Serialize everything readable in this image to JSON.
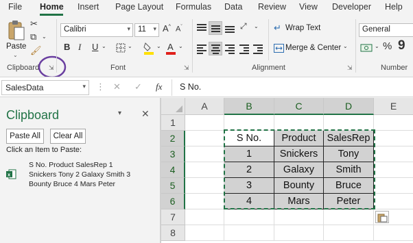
{
  "tabs": [
    "File",
    "Home",
    "Insert",
    "Page Layout",
    "Formulas",
    "Data",
    "Review",
    "View",
    "Developer",
    "Help"
  ],
  "active_tab": "Home",
  "accent_color": "#217346",
  "clipboard_group": {
    "paste_label": "Paste",
    "group_label": "Clipboard"
  },
  "font_group": {
    "font_name": "Calibri",
    "font_size": "11",
    "bold": "B",
    "italic": "I",
    "underline": "U",
    "group_label": "Font"
  },
  "alignment_group": {
    "wrap_text": "Wrap Text",
    "merge_center": "Merge & Center",
    "group_label": "Alignment"
  },
  "number_group": {
    "format": "General",
    "percent": "%",
    "comma": "9",
    "group_label": "Number"
  },
  "formula_bar": {
    "name_box": "SalesData",
    "fx": "fx",
    "content": "S No."
  },
  "clipboard_pane": {
    "title": "Clipboard",
    "paste_all": "Paste All",
    "clear_all": "Clear All",
    "instruction": "Click an Item to Paste:",
    "item_lines": [
      "S No. Product SalesRep 1",
      "Snickers Tony 2 Galaxy Smith 3",
      "Bounty Bruce 4 Mars Peter"
    ]
  },
  "sheet": {
    "columns": [
      "A",
      "B",
      "C",
      "D",
      "E"
    ],
    "rows": [
      "1",
      "2",
      "3",
      "4",
      "5",
      "6",
      "7",
      "8"
    ],
    "table": [
      [
        "S No.",
        "Product",
        "SalesRep"
      ],
      [
        "1",
        "Snickers",
        "Tony"
      ],
      [
        "2",
        "Galaxy",
        "Smith"
      ],
      [
        "3",
        "Bounty",
        "Bruce"
      ],
      [
        "4",
        "Mars",
        "Peter"
      ]
    ]
  }
}
